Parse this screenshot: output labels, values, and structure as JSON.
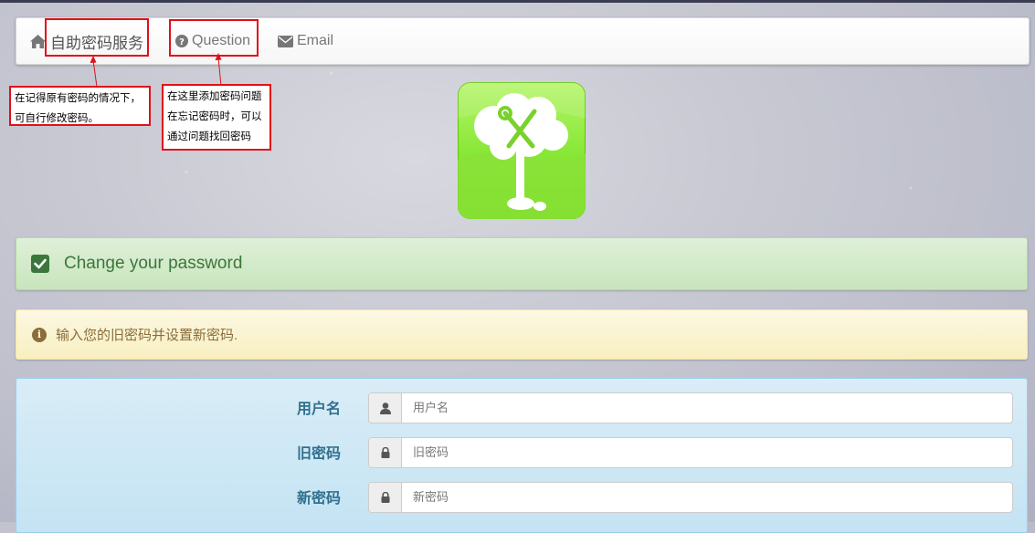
{
  "nav": {
    "home_label": "自助密码服务",
    "question_label": "Question",
    "email_label": "Email"
  },
  "annotations": {
    "home_note": [
      "在记得原有密码的情况下，",
      "可自行修改密码。"
    ],
    "question_note": [
      "在这里添加密码问题",
      "在忘记密码时，可以",
      "通过问题找回密码"
    ]
  },
  "alerts": {
    "success_text": "Change your password",
    "info_text": "输入您的旧密码并设置新密码."
  },
  "form": {
    "username_label": "用户名",
    "username_placeholder": "用户名",
    "old_password_label": "旧密码",
    "old_password_placeholder": "旧密码",
    "new_password_label": "新密码",
    "new_password_placeholder": "新密码"
  },
  "colors": {
    "success": "#3c763d",
    "warning": "#8a6d3b",
    "info": "#31708f",
    "annotation": "#e0101a"
  }
}
